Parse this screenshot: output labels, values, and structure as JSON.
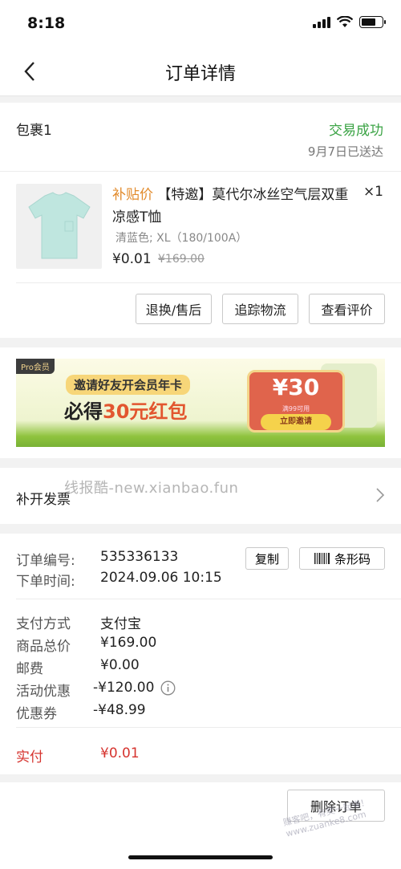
{
  "status_bar": {
    "time": "8:18"
  },
  "nav": {
    "title": "订单详情"
  },
  "package": {
    "label": "包裹1",
    "status": "交易成功",
    "delivered": "9月7日已送达",
    "product": {
      "tag": "补贴价",
      "title": "【特邀】莫代尔冰丝空气层双重凉感T恤",
      "qty": "×1",
      "spec": "清蓝色; XL（180/100A）",
      "price": "¥0.01",
      "original_price": "¥169.00",
      "image_color": "#bfe6df"
    },
    "buttons": {
      "return": "退换/售后",
      "track": "追踪物流",
      "review": "查看评价"
    }
  },
  "banner": {
    "badge": "Pro会员",
    "line1": "邀请好友开会员年卡",
    "line2_prefix": "必得",
    "line2_highlight": "30元红包",
    "coupon_amount": "¥30",
    "coupon_sub": "满99可用",
    "coupon_button": "立即邀请"
  },
  "invoice": {
    "label": "补开发票"
  },
  "watermark": "线报酷-new.xianbao.fun",
  "order": {
    "no_label": "订单编号:",
    "no_value": "535336133",
    "time_label": "下单时间:",
    "time_value": "2024.09.06 10:15",
    "copy_btn": "复制",
    "barcode_btn": "条形码",
    "payment_label": "支付方式",
    "payment_value": "支付宝",
    "total_label": "商品总价",
    "total_value": "¥169.00",
    "shipping_label": "邮费",
    "shipping_value": "¥0.00",
    "promo_label": "活动优惠",
    "promo_value": "-¥120.00",
    "coupon_label": "优惠券",
    "coupon_value": "-¥48.99",
    "paid_label": "实付",
    "paid_value": "¥0.01"
  },
  "footer": {
    "delete_btn": "删除订单"
  },
  "stamp": {
    "line1": "赚客吧，有奖一起赚！",
    "line2": "www.zuanke8.com"
  },
  "colors": {
    "success": "#3aa344",
    "accent_red": "#d6342f",
    "tag_orange": "#e28b2c"
  }
}
